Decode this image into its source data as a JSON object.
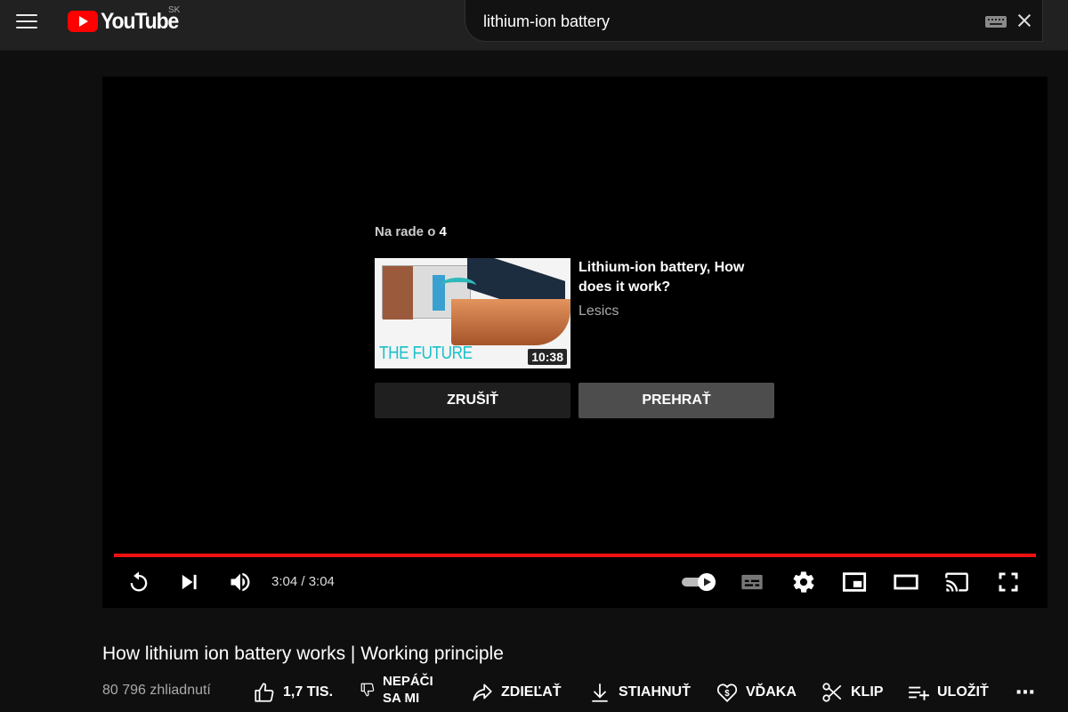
{
  "header": {
    "logo_text": "YouTube",
    "country_code": "SK",
    "search_value": "lithium-ion battery",
    "icons": [
      "menu-icon",
      "youtube-logo-icon",
      "keyboard-icon",
      "clear-icon"
    ]
  },
  "player": {
    "up_next_prefix": "Na rade o",
    "up_next_seconds": "4",
    "next_video": {
      "title": "Lithium-ion battery, How does it work?",
      "channel": "Lesics",
      "duration": "10:38",
      "thumbnail_text": "THE FUTURE"
    },
    "cancel_label": "ZRUŠIŤ",
    "play_label": "PREHRAŤ",
    "time_display": "3:04 / 3:04",
    "progress_fraction": 1.0,
    "progress_color": "#ee1111",
    "autoplay_on": true,
    "control_icons": [
      "replay-icon",
      "next-icon",
      "volume-icon",
      "autoplay-toggle-icon",
      "subtitles-icon",
      "settings-icon",
      "miniplayer-icon",
      "theater-icon",
      "cast-icon",
      "fullscreen-icon"
    ]
  },
  "video": {
    "title": "How lithium ion battery works | Working principle",
    "views": "80 796 zhliadnutí",
    "actions": {
      "like": "1,7 TIS.",
      "dislike_line1": "NEPÁČI",
      "dislike_line2": "SA MI",
      "share": "ZDIEĽAŤ",
      "download": "STIAHNUŤ",
      "thanks": "VĎAKA",
      "clip": "KLIP",
      "save": "ULOŽIŤ",
      "more": "⋯"
    }
  },
  "colors": {
    "brand_red": "#ff0000",
    "background": "#0f0f0f",
    "header_bg": "#212121"
  }
}
